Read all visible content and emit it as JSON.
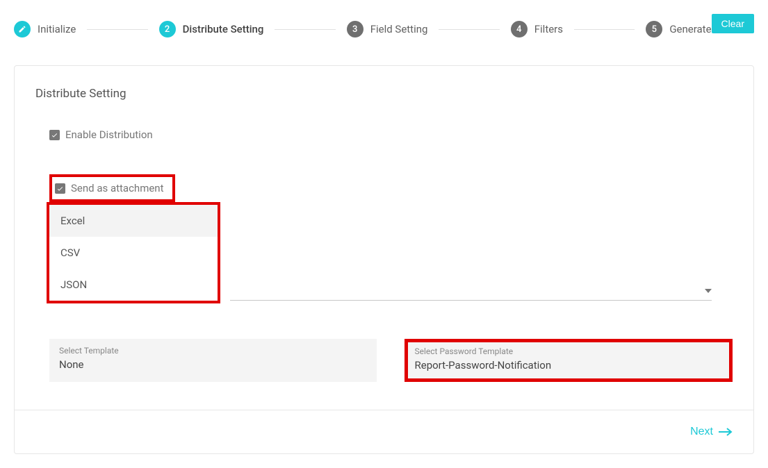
{
  "buttons": {
    "clear": "Clear",
    "next": "Next"
  },
  "steps": [
    {
      "label": "Initialize",
      "state": "completed"
    },
    {
      "num": "2",
      "label": "Distribute Setting",
      "state": "active"
    },
    {
      "num": "3",
      "label": "Field Setting",
      "state": "pending"
    },
    {
      "num": "4",
      "label": "Filters",
      "state": "pending"
    },
    {
      "num": "5",
      "label": "Generate",
      "state": "pending"
    }
  ],
  "panel": {
    "title": "Distribute Setting",
    "enable_distribution_label": "Enable Distribution",
    "enable_distribution_checked": true,
    "send_attachment_label": "Send as attachment",
    "send_attachment_checked": true,
    "format_options": [
      "Excel",
      "CSV",
      "JSON"
    ],
    "format_selected": "Excel",
    "template": {
      "label": "Select Template",
      "value": "None"
    },
    "password_template": {
      "label": "Select Password Template",
      "value": "Report-Password-Notification"
    }
  }
}
